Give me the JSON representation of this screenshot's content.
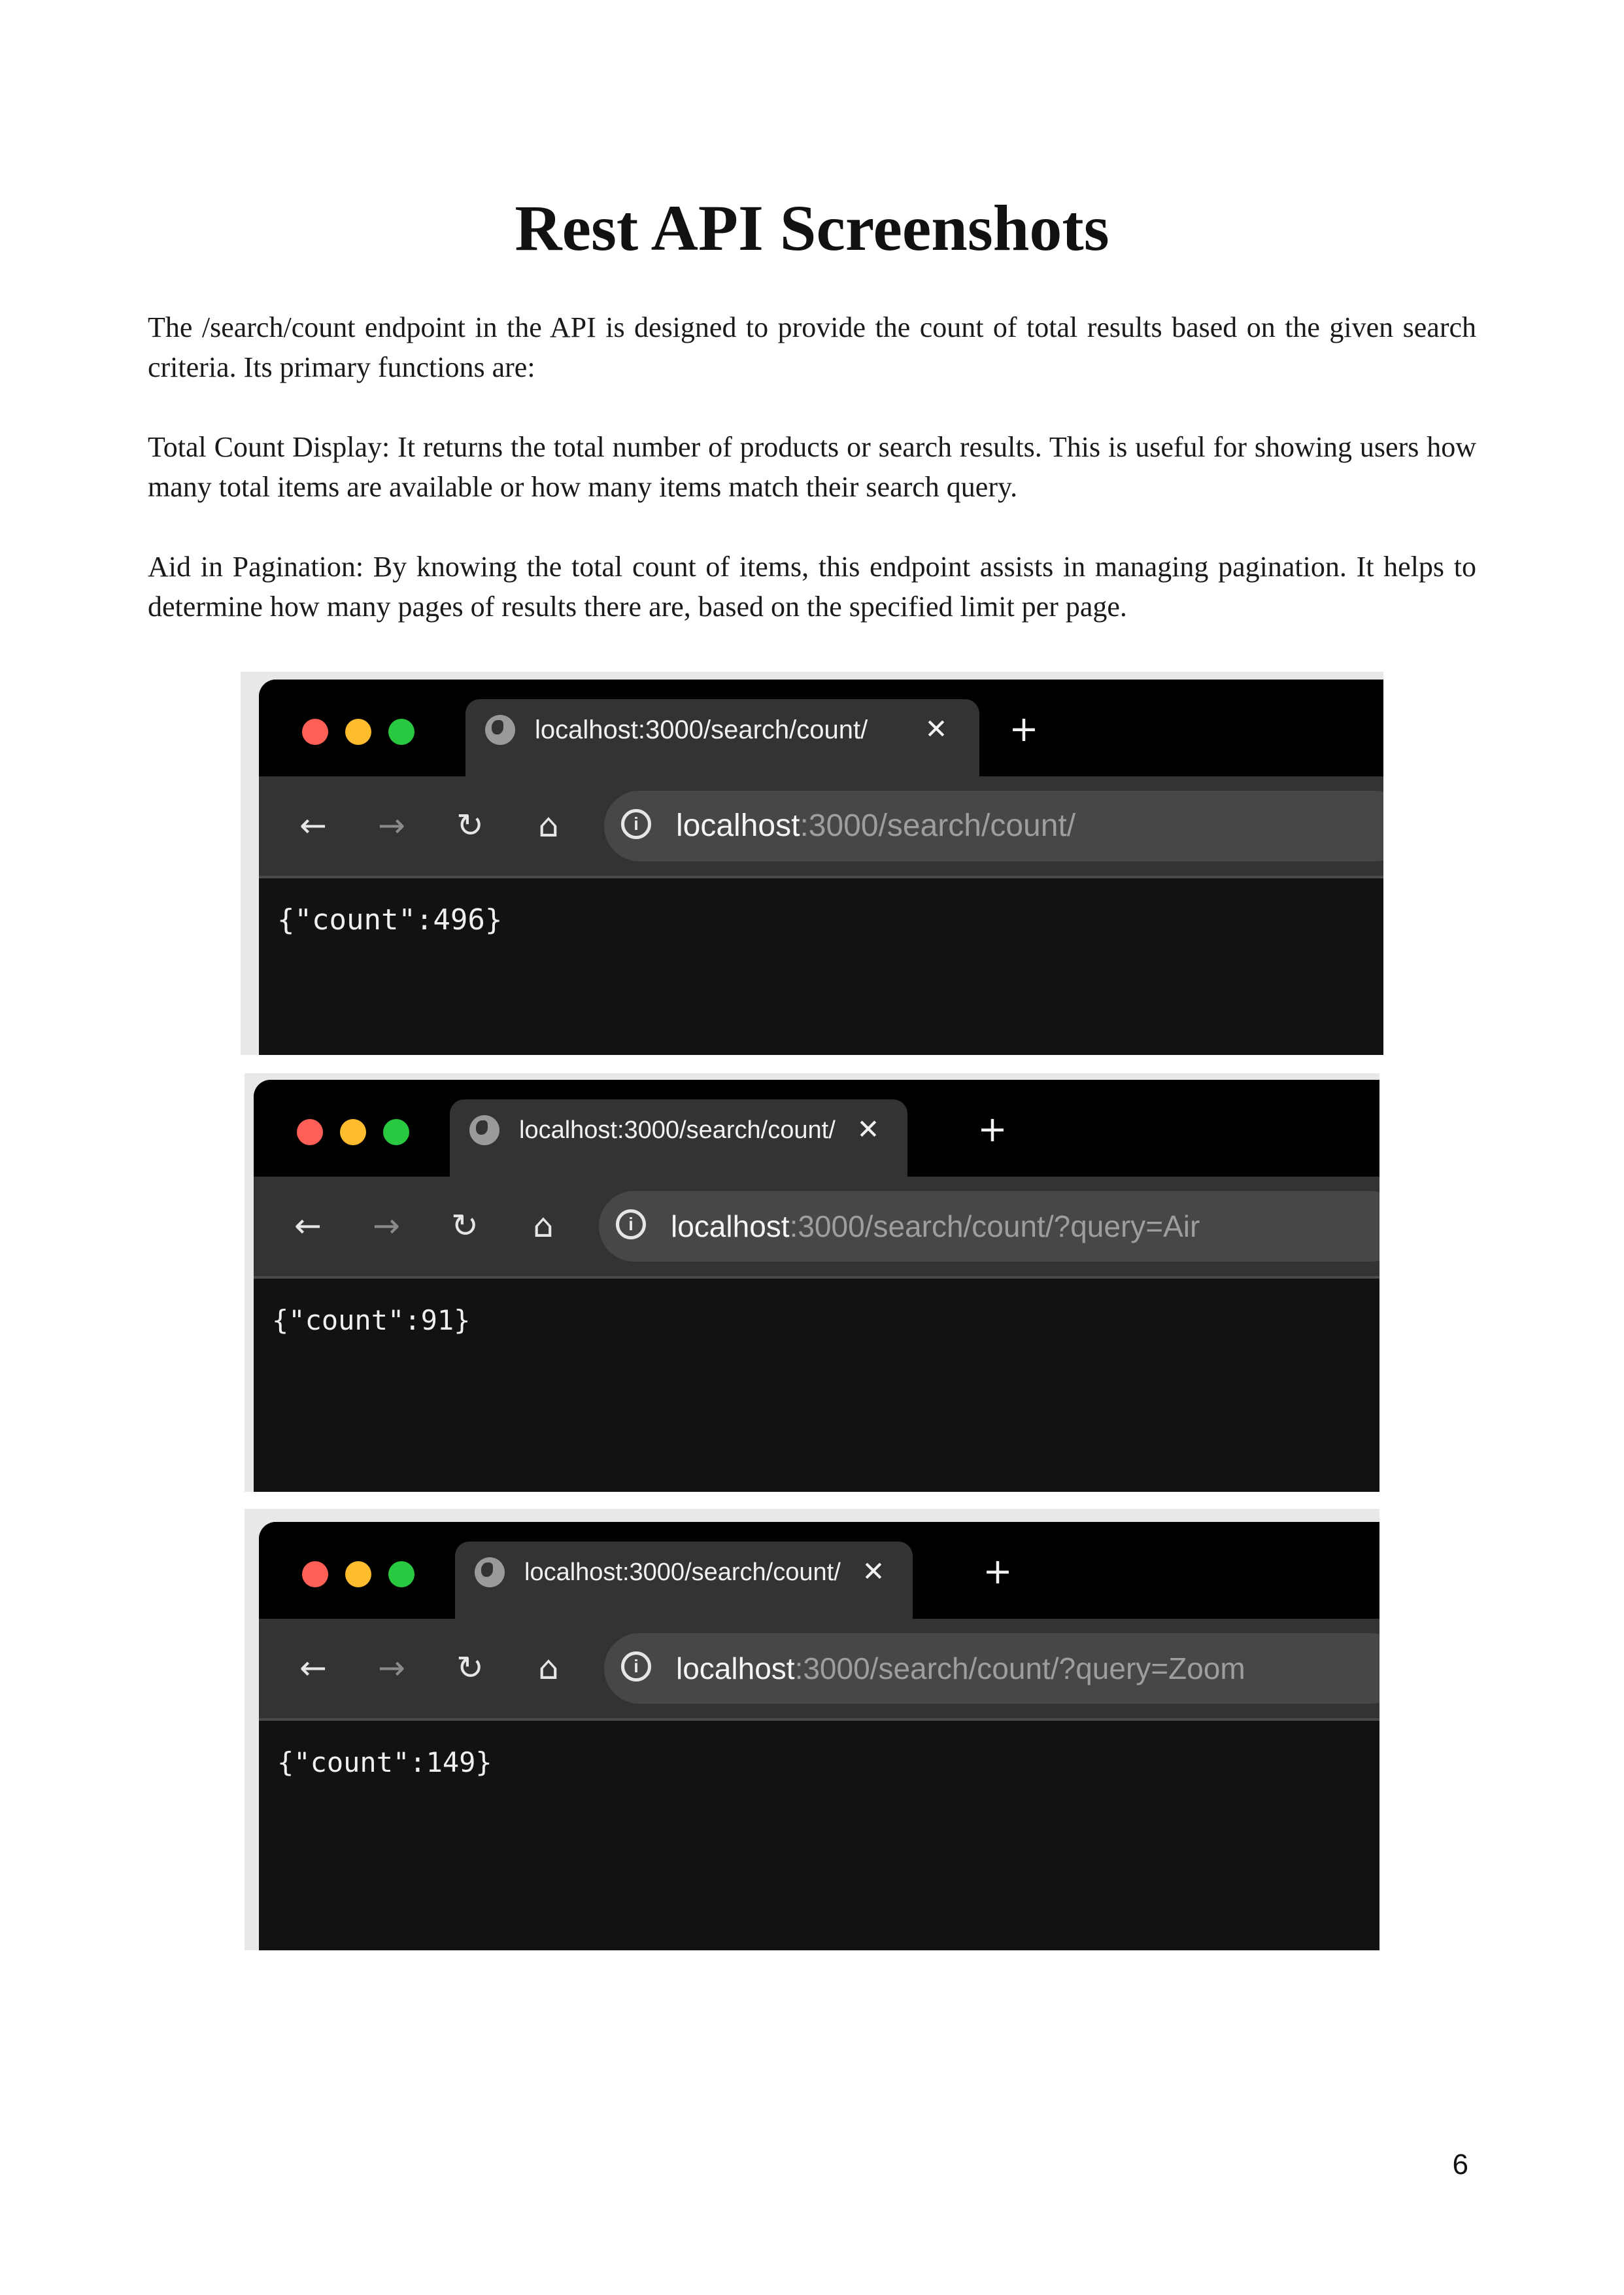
{
  "document": {
    "title": "Rest API Screenshots",
    "paragraphs": [
      "The /search/count endpoint in the API is designed to provide the count of total results based on the given search criteria. Its primary functions are:",
      "Total Count Display: It returns the total number of products or search results. This is useful for showing users how many total items are available or how many items match their search query.",
      "Aid in Pagination: By knowing the total count of items, this endpoint assists in managing pagination. It helps to determine how many pages of results there are, based on the specified limit per page."
    ],
    "page_number": "6"
  },
  "screenshots": [
    {
      "tab_title": "localhost:3000/search/count/",
      "tab_close": "✕",
      "new_tab": "+",
      "url_host": "localhost",
      "url_rest": ":3000/search/count/",
      "response": "{\"count\":496}"
    },
    {
      "tab_title": "localhost:3000/search/count/",
      "tab_close": "✕",
      "new_tab": "+",
      "url_host": "localhost",
      "url_rest": ":3000/search/count/?query=Air",
      "response": "{\"count\":91}"
    },
    {
      "tab_title": "localhost:3000/search/count/",
      "tab_close": "✕",
      "new_tab": "+",
      "url_host": "localhost",
      "url_rest": ":3000/search/count/?query=Zoom",
      "response": "{\"count\":149}"
    }
  ],
  "icons": {
    "back": "←",
    "forward": "→",
    "reload": "↻",
    "home": "⌂",
    "info": "i"
  },
  "colors": {
    "traffic_red": "#ff5f57",
    "traffic_yellow": "#febc2e",
    "traffic_green": "#28c840",
    "browser_frame": "#000000",
    "toolbar": "#333333",
    "content_bg": "#121212"
  }
}
